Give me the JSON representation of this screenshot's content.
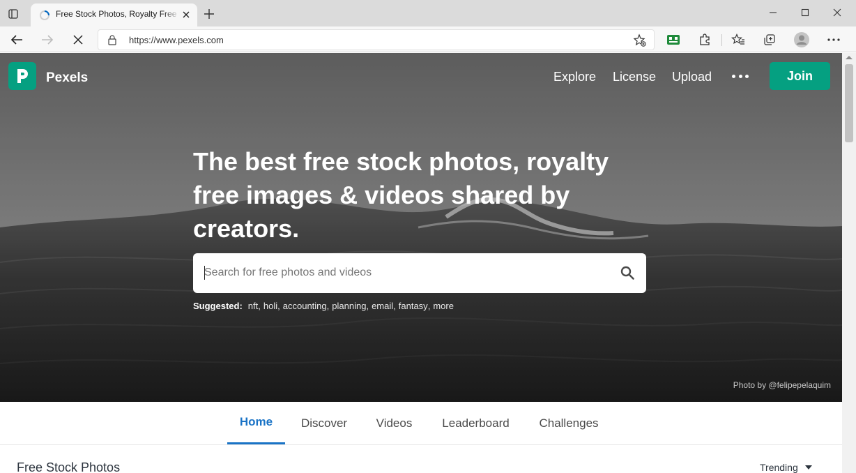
{
  "browser": {
    "tab_title": "Free Stock Photos, Royalty Free Stock Images & Copyright Free Pictures · Pexels",
    "url": "https://www.pexels.com"
  },
  "site": {
    "brand": "Pexels",
    "brand_color": "#05a081",
    "nav": {
      "explore": "Explore",
      "license": "License",
      "upload": "Upload",
      "join": "Join"
    }
  },
  "hero": {
    "headline": "The best free stock photos, royalty free images & videos shared by creators.",
    "search_placeholder": "Search for free photos and videos",
    "suggested_label": "Suggested:",
    "suggestions": [
      "nft",
      "holi",
      "accounting",
      "planning",
      "email",
      "fantasy",
      "more"
    ],
    "credit": "Photo by @felipepelaquim"
  },
  "page_tabs": [
    "Home",
    "Discover",
    "Videos",
    "Leaderboard",
    "Challenges"
  ],
  "active_tab": "Home",
  "accent_color": "#1a73c6",
  "section": {
    "title": "Free Stock Photos",
    "sort": "Trending"
  }
}
